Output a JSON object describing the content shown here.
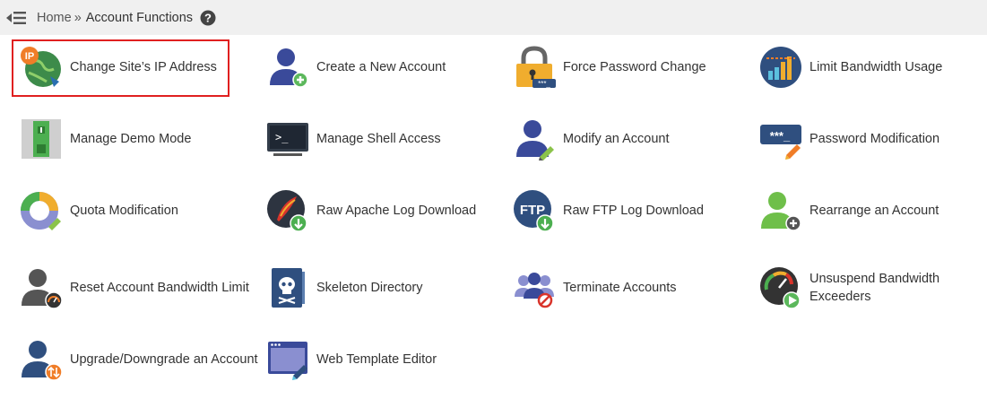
{
  "breadcrumb": {
    "home": "Home",
    "separator": "»",
    "current": "Account Functions"
  },
  "colors": {
    "highlight": "#e02020",
    "topbar": "#f0f0f0"
  },
  "items": [
    {
      "label": "Change Site’s IP Address",
      "icon": "ip-globe-icon",
      "selected": true
    },
    {
      "label": "Create a New Account",
      "icon": "user-add-icon"
    },
    {
      "label": "Force Password Change",
      "icon": "padlock-icon"
    },
    {
      "label": "Limit Bandwidth Usage",
      "icon": "bandwidth-chart-icon"
    },
    {
      "label": "Manage Demo Mode",
      "icon": "demo-switch-icon"
    },
    {
      "label": "Manage Shell Access",
      "icon": "terminal-icon"
    },
    {
      "label": "Modify an Account",
      "icon": "user-edit-icon"
    },
    {
      "label": "Password Modification",
      "icon": "password-edit-icon"
    },
    {
      "label": "Quota Modification",
      "icon": "quota-donut-icon"
    },
    {
      "label": "Raw Apache Log Download",
      "icon": "apache-feather-icon"
    },
    {
      "label": "Raw FTP Log Download",
      "icon": "ftp-download-icon"
    },
    {
      "label": "Rearrange an Account",
      "icon": "user-move-icon"
    },
    {
      "label": "Reset Account Bandwidth Limit",
      "icon": "user-gauge-icon"
    },
    {
      "label": "Skeleton Directory",
      "icon": "skull-book-icon"
    },
    {
      "label": "Terminate Accounts",
      "icon": "users-terminate-icon"
    },
    {
      "label": "Unsuspend Bandwidth Exceeders",
      "icon": "gauge-play-icon"
    },
    {
      "label": "Upgrade/Downgrade an Account",
      "icon": "user-updown-icon"
    },
    {
      "label": "Web Template Editor",
      "icon": "web-template-icon"
    }
  ]
}
